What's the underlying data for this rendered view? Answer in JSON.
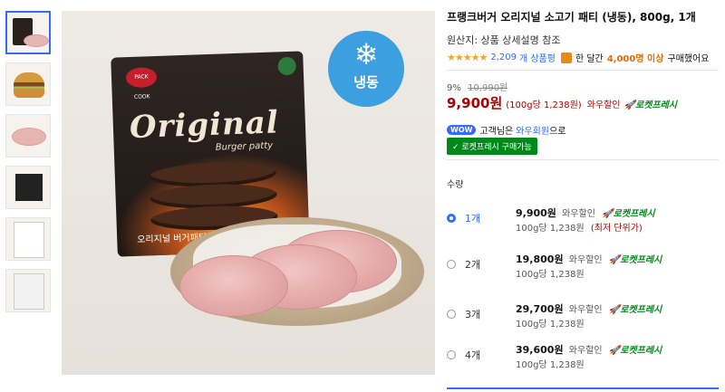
{
  "product": {
    "title": "프랭크버거 오리지널 소고기 패티 (냉동), 800g, 1개",
    "origin": "원산지: 상품 상세설명 참조",
    "rating_stars": "★★★★★",
    "review_count": "2,209",
    "review_suffix": "개 상품평",
    "bag_icon": "shopping-bag-icon",
    "purchase_prefix": "한 달간",
    "purchase_count": "4,000명 이상",
    "purchase_suffix": "구매했어요"
  },
  "pricing": {
    "discount_rate": "9%",
    "original_price": "10,990원",
    "sale_price": "9,900원",
    "unit_price": "(100g당 1,238원)",
    "wow_label": "와우할인",
    "rocket_label": "로켓프레시"
  },
  "wow": {
    "badge": "WOW",
    "text_prefix": "고객님은",
    "member_link": "와우회원",
    "text_suffix": "으로",
    "rocket_button": "✓ 로켓프레시 구매가능"
  },
  "image": {
    "freeze_icon": "snowflake-icon",
    "freeze_label": "냉동",
    "bag_brand": "PACK COOK",
    "bag_title": "Original",
    "bag_subtitle": "Burger patty",
    "bag_korean": "오리지널 버거패티"
  },
  "quantity": {
    "label": "수량",
    "options": [
      {
        "qty": "1개",
        "price": "9,900원",
        "wow": "와우할인",
        "rocket": "로켓프레시",
        "unit": "100g당 1,238원",
        "lowest": "(최저 단위가)",
        "selected": true
      },
      {
        "qty": "2개",
        "price": "19,800원",
        "wow": "와우할인",
        "rocket": "로켓프레시",
        "unit": "100g당 1,238원",
        "lowest": "",
        "selected": false
      },
      {
        "qty": "3개",
        "price": "29,700원",
        "wow": "와우할인",
        "rocket": "로켓프레시",
        "unit": "100g당 1,238원",
        "lowest": "",
        "selected": false
      },
      {
        "qty": "4개",
        "price": "39,600원",
        "wow": "와우할인",
        "rocket": "로켓프레시",
        "unit": "100g당 1,238원",
        "lowest": "",
        "selected": false
      }
    ]
  },
  "colors": {
    "accent_blue": "#346aff",
    "price_red": "#ae0000",
    "rocket_green": "#00891a",
    "highlight_orange": "#e56a00"
  }
}
